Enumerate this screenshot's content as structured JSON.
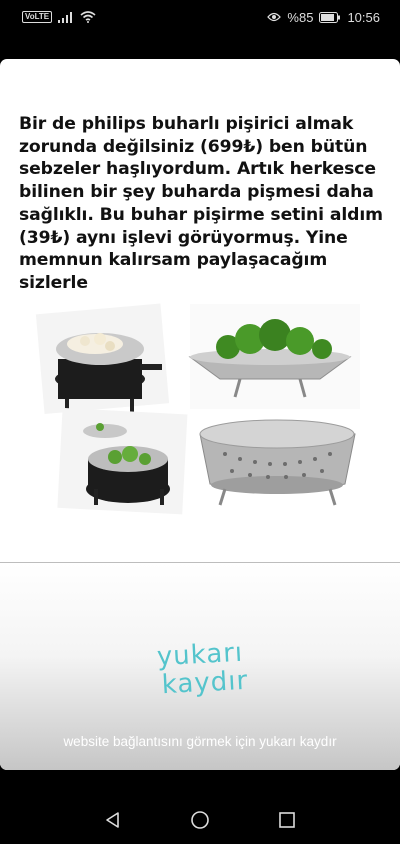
{
  "status_bar": {
    "network_label": "VoLTE",
    "battery_percent": "%85",
    "time": "10:56",
    "icons": [
      "volte-icon",
      "signal-icon",
      "wifi-icon",
      "eye-icon",
      "battery-icon"
    ]
  },
  "story": {
    "caption": "Bir de philips buharlı pişirici almak zorunda değilsiniz (699₺) ben bütün sebzeler haşlıyordum. Artık herkesce bilinen bir şey buharda pişmesi daha sağlıklı. Bu buhar pişirme setini aldım (39₺) aynı işlevi görüyormuş. Yine memnun kalırsam paylaşacağım sizlerle",
    "images": [
      "steamer-with-cauliflower",
      "steamer-with-broccoli",
      "steamer-in-pot-broccoli",
      "empty-steamer-basket"
    ]
  },
  "swipe": {
    "logo_line1": "yukarı",
    "logo_line2": "kaydır",
    "hint": "website bağlantısını görmek için yukarı kaydır",
    "accent": "#54c4cc"
  },
  "nav": {
    "icons": [
      "back-icon",
      "home-icon",
      "recents-icon"
    ]
  }
}
